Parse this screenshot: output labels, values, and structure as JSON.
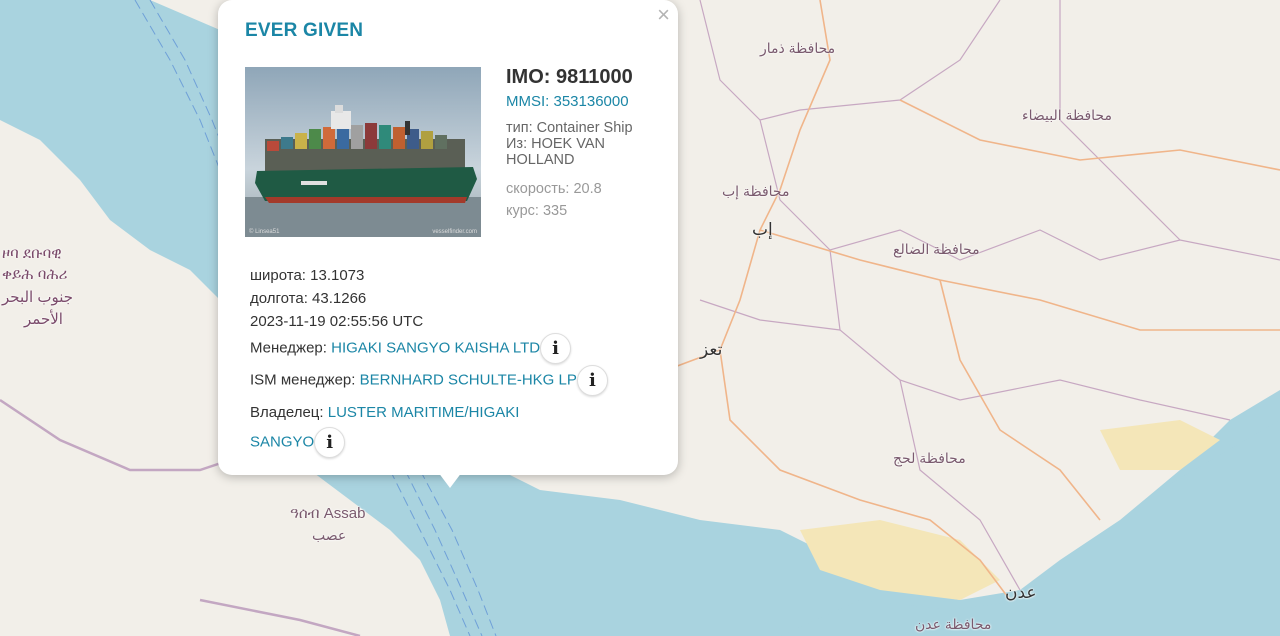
{
  "map": {
    "labels": {
      "dhamar": "محافظة ذمار",
      "bayda": "محافظة البيضاء",
      "ibb_gov": "محافظة إب",
      "ibb": "إب",
      "dhale": "محافظة الضالع",
      "taiz": "تعز",
      "lahij": "محافظة لحج",
      "aden": "عدن",
      "aden_gov": "محافظة عدن",
      "assab": "ዓሰብ Assab",
      "assab_ar": "عصب",
      "eritrea_1": "ዞባ ደቡባዊ",
      "eritrea_2": "ቀይሕ ባሕሪ",
      "eritrea_3": "جنوب البحر",
      "eritrea_4": "الأحمر"
    }
  },
  "popup": {
    "ship_name": "EVER GIVEN",
    "close_symbol": "×",
    "photo_credit_left": "© Linsea51",
    "photo_credit_right": "vesselfinder.com",
    "imo": "IMO: 9811000",
    "mmsi": "MMSI: 353136000",
    "type_label": "тип: Container Ship",
    "from_label": "Из: HOEK VAN HOLLAND",
    "speed_label": "скорость: 20.8",
    "course_label": "курс: 335",
    "latitude": "широта: 13.1073",
    "longitude": "долгота: 43.1266",
    "timestamp": "2023-11-19 02:55:56 UTC",
    "manager_label": "Менеджер:",
    "manager_value": "HIGAKI SANGYO KAISHA LTD",
    "ism_label": "ISM менеджер:",
    "ism_value": "BERNHARD SCHULTE-HKG LP",
    "owner_label": "Владелец:",
    "owner_value_1": "LUSTER MARITIME/HIGAKI",
    "owner_value_2": "SANGYO",
    "info_symbol": "i"
  }
}
